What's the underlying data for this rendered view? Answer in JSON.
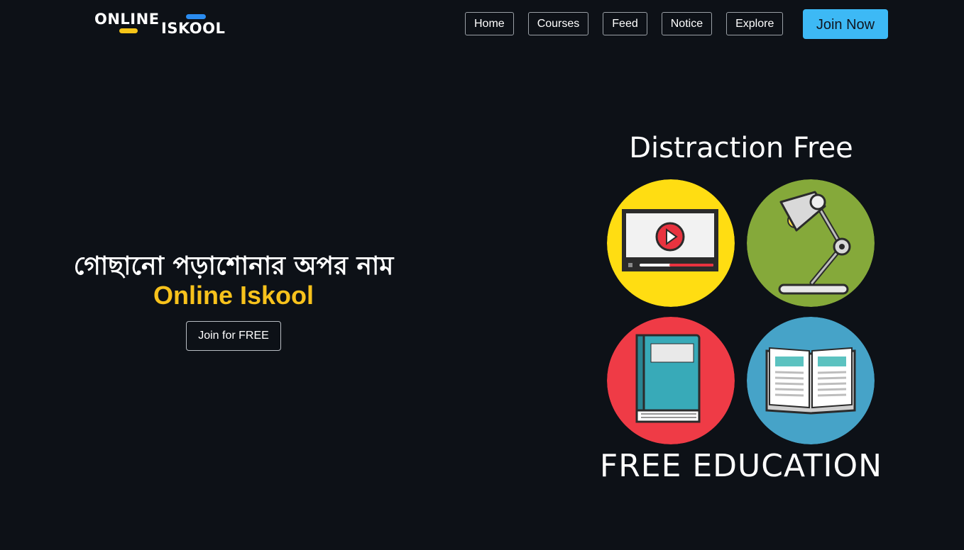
{
  "header": {
    "logo": {
      "line1": "ONLINE",
      "line2": "ISKOOL",
      "accent_yellow": "#f5c518",
      "accent_blue": "#2a8cf0"
    },
    "nav": [
      {
        "label": "Home"
      },
      {
        "label": "Courses"
      },
      {
        "label": "Feed"
      },
      {
        "label": "Notice"
      },
      {
        "label": "Explore"
      }
    ],
    "cta": {
      "label": "Join Now",
      "color": "#3db9f5"
    }
  },
  "hero": {
    "tagline": "গোছানো পড়াশোনার অপর নাম",
    "brand": "Online Iskool",
    "brand_color": "#f7c21c",
    "button_label": "Join for FREE"
  },
  "illustration": {
    "title": "Distraction Free",
    "footer": "FREE EDUCATION",
    "tiles": [
      {
        "icon": "video-player-icon",
        "bg": "#ffdd12"
      },
      {
        "icon": "desk-lamp-icon",
        "bg": "#85a93a"
      },
      {
        "icon": "closed-book-icon",
        "bg": "#ef3b46"
      },
      {
        "icon": "open-book-icon",
        "bg": "#46a3c8"
      }
    ]
  }
}
